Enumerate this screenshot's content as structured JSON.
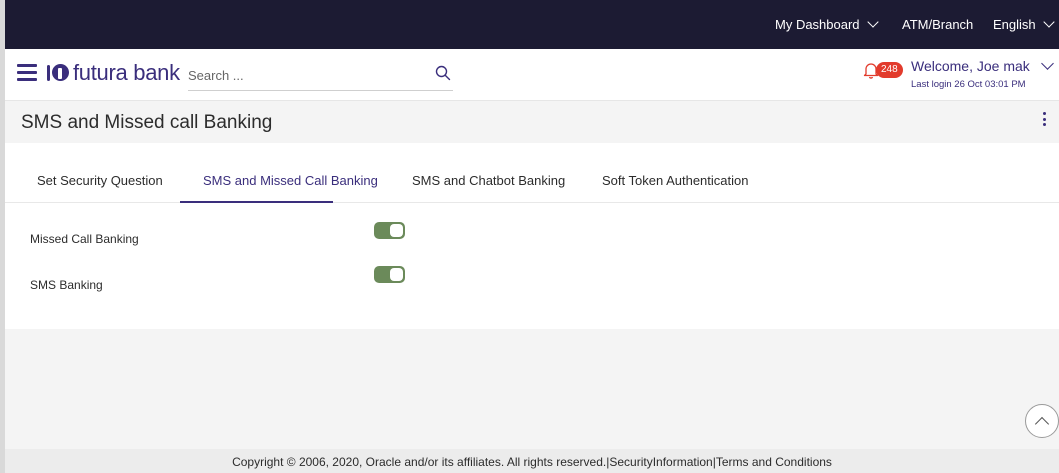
{
  "topbar": {
    "dashboard": "My Dashboard",
    "atm_branch": "ATM/Branch",
    "language": "English"
  },
  "header": {
    "brand": "futura bank",
    "search_placeholder": "Search ...",
    "notification_count": "248",
    "welcome": "Welcome, Joe mak",
    "last_login": "Last login 26 Oct 03:01 PM"
  },
  "page": {
    "title": "SMS and Missed call Banking"
  },
  "tabs": [
    {
      "label": "Set Security Question",
      "active": false
    },
    {
      "label": "SMS and Missed Call Banking",
      "active": true
    },
    {
      "label": "SMS and Chatbot Banking",
      "active": false
    },
    {
      "label": "Soft Token Authentication",
      "active": false
    }
  ],
  "settings": [
    {
      "label": "Missed Call Banking",
      "enabled": true
    },
    {
      "label": "SMS Banking",
      "enabled": true
    }
  ],
  "footer": {
    "copyright": "Copyright © 2006, 2020, Oracle and/or its affiliates. All rights reserved.|",
    "security_link": "SecurityInformation",
    "separator": "|",
    "terms_link": "Terms and Conditions"
  },
  "colors": {
    "brand": "#3a2e7c",
    "topbar_bg": "#1c1b33",
    "toggle_on": "#6b8a5a",
    "badge": "#e23b2c"
  }
}
